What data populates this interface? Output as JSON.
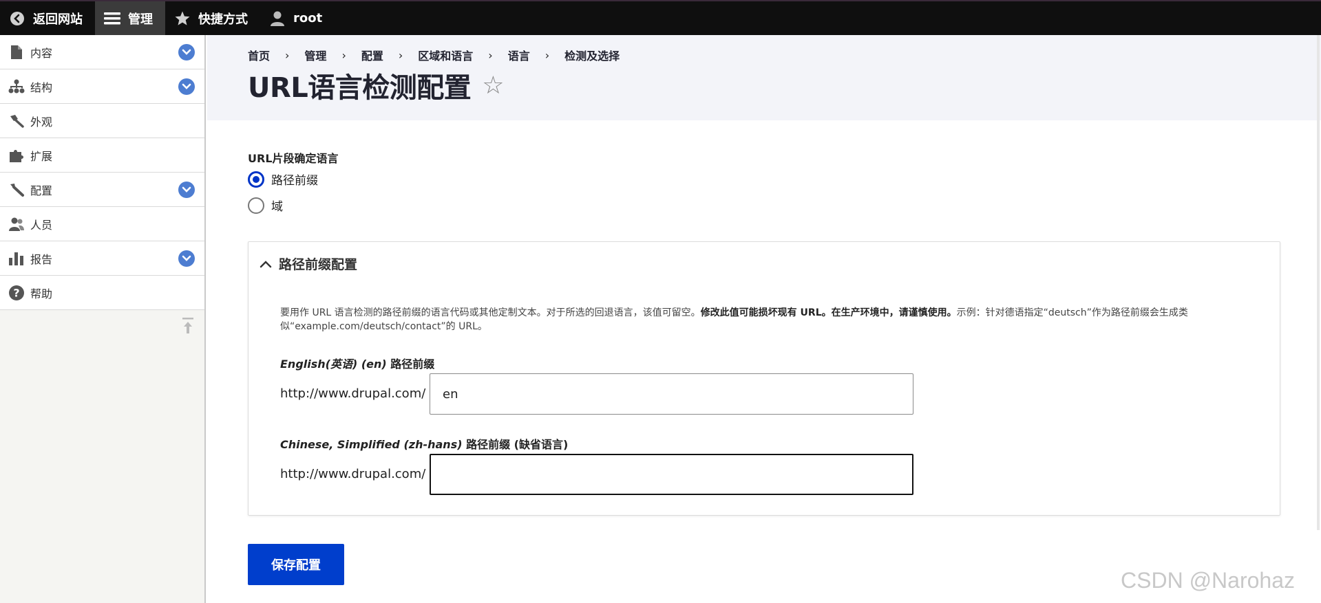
{
  "toolbar": {
    "back": "返回网站",
    "manage": "管理",
    "shortcuts": "快捷方式",
    "user": "root"
  },
  "sidebar": {
    "items": [
      {
        "label": "内容",
        "icon": "file-icon",
        "expandable": true
      },
      {
        "label": "结构",
        "icon": "sitemap-icon",
        "expandable": true
      },
      {
        "label": "外观",
        "icon": "brush-icon",
        "expandable": false
      },
      {
        "label": "扩展",
        "icon": "puzzle-icon",
        "expandable": false
      },
      {
        "label": "配置",
        "icon": "wrench-icon",
        "expandable": true
      },
      {
        "label": "人员",
        "icon": "people-icon",
        "expandable": false
      },
      {
        "label": "报告",
        "icon": "bar-chart-icon",
        "expandable": true
      },
      {
        "label": "帮助",
        "icon": "help-icon",
        "expandable": false
      }
    ]
  },
  "breadcrumb": [
    "首页",
    "管理",
    "配置",
    "区域和语言",
    "语言",
    "检测及选择"
  ],
  "page": {
    "title": "URL语言检测配置"
  },
  "form": {
    "radio_group_label": "URL片段确定语言",
    "radio_options": [
      {
        "label": "路径前缀",
        "checked": true
      },
      {
        "label": "域",
        "checked": false
      }
    ],
    "details": {
      "summary": "路径前缀配置",
      "desc_part1": "要用作 URL 语言检测的路径前缀的语言代码或其他定制文本。对于所选的回退语言，该值可留空。",
      "desc_bold": "修改此值可能损坏现有 URL。在生产环境中，请谨慎使用。",
      "desc_part2": "示例：针对德语指定“deutsch”作为路径前缀会生成类似“example.com/deutsch/contact”的 URL。",
      "fields": [
        {
          "label_italic": "English(英语) (en)",
          "label_rest": " 路径前缀",
          "prefix": "http://www.drupal.com/",
          "value": "en"
        },
        {
          "label_italic": "Chinese, Simplified (zh-hans)",
          "label_rest": " 路径前缀 (缺省语言)",
          "prefix": "http://www.drupal.com/",
          "value": ""
        }
      ]
    },
    "save_label": "保存配置"
  },
  "watermark": "CSDN @Narohaz",
  "colors": {
    "primary": "#003ecc",
    "toolbar_bg": "#0f0f0f",
    "chevron_blue": "#4d7dd1"
  }
}
